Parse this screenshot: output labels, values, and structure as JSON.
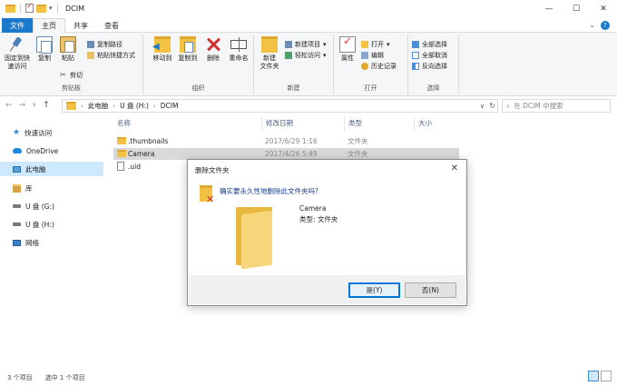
{
  "window": {
    "title": "DCIM",
    "min": "—",
    "max": "☐",
    "close": "✕"
  },
  "ribbon": {
    "tabs": [
      "文件",
      "主页",
      "共享",
      "查看"
    ],
    "clipboard": {
      "pin": "固定到快速访问",
      "copy": "复制",
      "paste": "粘贴",
      "copy_path": "复制路径",
      "paste_shortcut": "粘贴快捷方式",
      "cut": "剪切",
      "label": "剪贴板"
    },
    "organize": {
      "move_to": "移动到",
      "copy_to": "复制到",
      "delete": "删除",
      "rename": "重命名",
      "label": "组织"
    },
    "new": {
      "new_folder": "新建\n文件夹",
      "new_item": "新建项目",
      "easy_access": "轻松访问",
      "label": "新建"
    },
    "open": {
      "properties": "属性",
      "open": "打开",
      "edit": "编辑",
      "history": "历史记录",
      "label": "打开"
    },
    "select": {
      "select_all": "全部选择",
      "select_none": "全部取消",
      "invert": "反向选择",
      "label": "选择"
    }
  },
  "address": {
    "crumbs": [
      "此电脑",
      "U 盘 (H:)",
      "DCIM"
    ],
    "search_placeholder": "搜索\"DCIM\"",
    "search_text": "在 DCIM 中搜索"
  },
  "nav_pane": [
    {
      "label": "快速访问",
      "icon": "star-icon"
    },
    {
      "label": "OneDrive",
      "icon": "cloud-icon"
    },
    {
      "label": "此电脑",
      "icon": "computer-icon"
    },
    {
      "label": "库",
      "icon": "library-icon"
    },
    {
      "label": "U 盘 (G:)",
      "icon": "usb-drive-icon"
    },
    {
      "label": "U 盘 (H:)",
      "icon": "usb-drive-icon"
    },
    {
      "label": "网络",
      "icon": "network-icon"
    }
  ],
  "file_list": {
    "columns": [
      "名称",
      "修改日期",
      "类型",
      "大小"
    ],
    "rows": [
      {
        "name": ".thumbnails",
        "date": "2017/6/29 1:16",
        "type": "文件夹"
      },
      {
        "name": "Camera",
        "date": "2017/4/26 5:49",
        "type": "文件夹"
      },
      {
        "name": ".uid",
        "date": "",
        "type": ""
      }
    ]
  },
  "dialog": {
    "title": "删除文件夹",
    "question": "确实要永久性地删除此文件夹吗?",
    "item_name": "Camera",
    "item_type": "类型: 文件夹",
    "yes": "是(Y)",
    "no": "否(N)"
  },
  "status": {
    "count": "3 个项目",
    "selected": "选中 1 个项目"
  }
}
